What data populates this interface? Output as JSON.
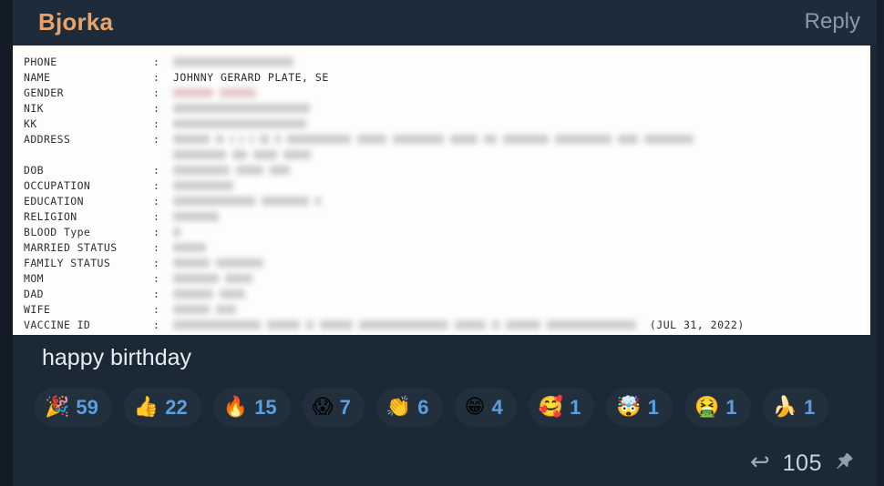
{
  "header": {
    "channel_title": "Bjorka",
    "reply_label": "Reply"
  },
  "document": {
    "rows": [
      {
        "label": "PHONE",
        "separator": ":",
        "value": "",
        "redacted": true,
        "bars": [
          132
        ]
      },
      {
        "label": "NAME",
        "separator": ":",
        "value": "JOHNNY GERARD PLATE, SE",
        "redacted": false,
        "bars": []
      },
      {
        "label": "GENDER",
        "separator": ":",
        "value": "",
        "redacted": true,
        "pink": true,
        "bars": [
          44,
          40
        ]
      },
      {
        "label": "NIK",
        "separator": ":",
        "value": "",
        "redacted": true,
        "bars": [
          150
        ]
      },
      {
        "label": "KK",
        "separator": ":",
        "value": "",
        "redacted": true,
        "bars": [
          146
        ]
      },
      {
        "label": "ADDRESS",
        "separator": ":",
        "value": "",
        "redacted": true,
        "bars": [
          40,
          8,
          4,
          4,
          4,
          10,
          6,
          70,
          32,
          56,
          30,
          14,
          50,
          62,
          22,
          54
        ],
        "wrap": [
          58,
          16,
          26,
          30
        ]
      },
      {
        "label": "DOB",
        "separator": ":",
        "value": "",
        "redacted": true,
        "bars": [
          62,
          30,
          22
        ]
      },
      {
        "label": "OCCUPATION",
        "separator": ":",
        "value": "",
        "redacted": true,
        "bars": [
          66
        ]
      },
      {
        "label": "EDUCATION",
        "separator": ":",
        "value": "",
        "redacted": true,
        "bars": [
          90,
          52,
          6
        ]
      },
      {
        "label": "RELIGION",
        "separator": ":",
        "value": "",
        "redacted": true,
        "bars": [
          50
        ]
      },
      {
        "label": "BLOOD Type",
        "separator": ":",
        "value": "",
        "redacted": true,
        "bars": [
          8
        ]
      },
      {
        "label": "MARRIED STATUS",
        "separator": ":",
        "value": "",
        "redacted": true,
        "bars": [
          36
        ]
      },
      {
        "label": "FAMILY STATUS",
        "separator": ":",
        "value": "",
        "redacted": true,
        "bars": [
          40,
          52
        ]
      },
      {
        "label": "MOM",
        "separator": ":",
        "value": "",
        "redacted": true,
        "bars": [
          50,
          30
        ]
      },
      {
        "label": "DAD",
        "separator": ":",
        "value": "",
        "redacted": true,
        "bars": [
          44,
          28
        ]
      },
      {
        "label": "WIFE",
        "separator": ":",
        "value": "",
        "redacted": true,
        "bars": [
          40,
          22
        ]
      },
      {
        "label": "VACCINE ID",
        "separator": ":",
        "value": "",
        "redacted": true,
        "bars": [
          96,
          36,
          8,
          36,
          98,
          34,
          8,
          38,
          98
        ],
        "suffix": "(JUL 31, 2022)"
      }
    ]
  },
  "message": {
    "text": "happy birthday"
  },
  "reactions": [
    {
      "name": "party-popper",
      "emoji": "🎉",
      "count": "59"
    },
    {
      "name": "thumbs-up",
      "emoji": "👍",
      "count": "22"
    },
    {
      "name": "fire",
      "emoji": "🔥",
      "count": "15"
    },
    {
      "name": "screaming-face",
      "emoji": "😱",
      "count": "7"
    },
    {
      "name": "clapping-hands",
      "emoji": "👏",
      "count": "6"
    },
    {
      "name": "grinning-face",
      "emoji": "😁",
      "count": "4"
    },
    {
      "name": "smiling-face-with-hearts",
      "emoji": "🥰",
      "count": "1"
    },
    {
      "name": "exploding-head",
      "emoji": "🤯",
      "count": "1"
    },
    {
      "name": "vomiting-face",
      "emoji": "🤮",
      "count": "1"
    },
    {
      "name": "banana",
      "emoji": "🍌",
      "count": "1"
    }
  ],
  "footer": {
    "reply_arrow_icon": "reply-arrow-icon",
    "reply_count": "105",
    "pin_icon": "pin-icon"
  },
  "colors": {
    "card_background": "#1b2836",
    "header_background": "#1d2b3a",
    "channel_title": "#e8a36a",
    "reply_link": "#8b9aa8",
    "document_background": "#fdfdfc",
    "chip_background": "#22303e",
    "chip_count": "#5a9fe0",
    "message_text": "#e9edf1"
  }
}
